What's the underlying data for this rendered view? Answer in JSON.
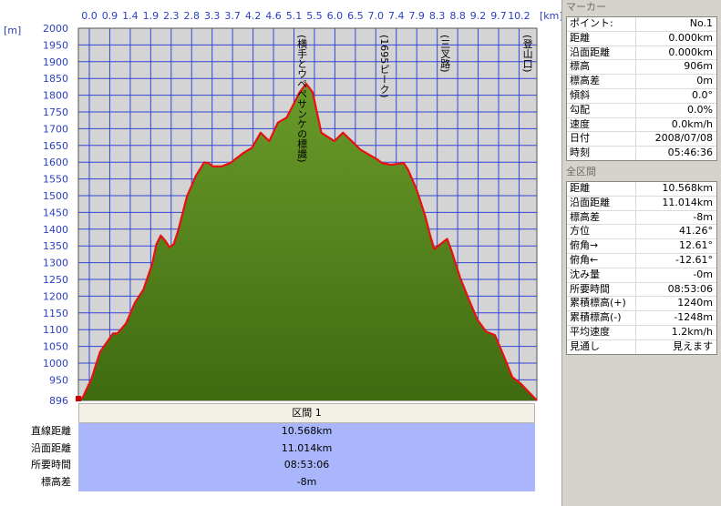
{
  "chart_data": {
    "type": "area",
    "x_unit_label": "[km]",
    "y_unit_label": "[m]",
    "x_ticks": [
      "0.0",
      "0.9",
      "1.4",
      "1.9",
      "2.3",
      "2.8",
      "3.3",
      "3.7",
      "4.2",
      "4.6",
      "5.1",
      "5.5",
      "6.0",
      "6.5",
      "7.0",
      "7.4",
      "7.9",
      "8.3",
      "8.8",
      "9.2",
      "9.7",
      "10.2"
    ],
    "y_ticks": [
      "2000",
      "1950",
      "1900",
      "1850",
      "1800",
      "1750",
      "1700",
      "1650",
      "1600",
      "1550",
      "1500",
      "1450",
      "1400",
      "1350",
      "1300",
      "1250",
      "1200",
      "1150",
      "1100",
      "1050",
      "1000",
      "950",
      "896"
    ],
    "xlim": [
      0,
      10.568
    ],
    "ylim": [
      896,
      2000
    ],
    "x": [
      0,
      0.1,
      0.3,
      0.5,
      0.8,
      0.9,
      1.1,
      1.3,
      1.5,
      1.7,
      1.8,
      1.9,
      2.0,
      2.1,
      2.2,
      2.3,
      2.5,
      2.7,
      2.9,
      3.0,
      3.1,
      3.3,
      3.5,
      3.8,
      4.0,
      4.2,
      4.4,
      4.6,
      4.8,
      5.0,
      5.1,
      5.25,
      5.4,
      5.6,
      5.9,
      6.1,
      6.3,
      6.5,
      6.7,
      6.9,
      7.0,
      7.2,
      7.5,
      7.6,
      7.8,
      8.0,
      8.1,
      8.2,
      8.35,
      8.5,
      8.6,
      8.8,
      9.0,
      9.2,
      9.4,
      9.6,
      9.8,
      10.0,
      10.2,
      10.568
    ],
    "y": [
      896,
      905,
      960,
      1040,
      1095,
      1095,
      1125,
      1185,
      1225,
      1300,
      1360,
      1385,
      1370,
      1350,
      1360,
      1400,
      1500,
      1560,
      1602,
      1600,
      1590,
      1590,
      1600,
      1630,
      1645,
      1690,
      1665,
      1720,
      1735,
      1785,
      1810,
      1835,
      1810,
      1690,
      1665,
      1690,
      1665,
      1640,
      1625,
      1610,
      1600,
      1595,
      1600,
      1580,
      1520,
      1440,
      1390,
      1345,
      1360,
      1375,
      1340,
      1260,
      1195,
      1135,
      1100,
      1090,
      1030,
      965,
      945,
      896
    ],
    "annotations": [
      {
        "text": "(横手とウペペサンケの標識)",
        "x": 5.15
      },
      {
        "text": "(1695ピーク)",
        "x": 7.05
      },
      {
        "text": "(三叉路)",
        "x": 8.45
      },
      {
        "text": "(登山口)",
        "x": 10.35
      }
    ]
  },
  "section": {
    "header": "区間 1",
    "rows": [
      {
        "label": "直線距離",
        "value": "10.568km"
      },
      {
        "label": "沿面距離",
        "value": "11.014km"
      },
      {
        "label": "所要時間",
        "value": "08:53:06"
      },
      {
        "label": "標高差",
        "value": "-8m"
      }
    ]
  },
  "panel": {
    "marker_title": "マーカー",
    "marker_rows": [
      {
        "k": "ポイント:",
        "v": "No.1"
      },
      {
        "k": "距離",
        "v": "0.000km"
      },
      {
        "k": "沿面距離",
        "v": "0.000km"
      },
      {
        "k": "標高",
        "v": "906m"
      },
      {
        "k": "標高差",
        "v": "0m"
      },
      {
        "k": "傾斜",
        "v": "0.0°"
      },
      {
        "k": "勾配",
        "v": "0.0%"
      },
      {
        "k": "速度",
        "v": "0.0km/h"
      },
      {
        "k": "日付",
        "v": "2008/07/08"
      },
      {
        "k": "時刻",
        "v": "05:46:36"
      }
    ],
    "total_title": "全区間",
    "total_rows": [
      {
        "k": "距離",
        "v": "10.568km"
      },
      {
        "k": "沿面距離",
        "v": "11.014km"
      },
      {
        "k": "標高差",
        "v": "-8m"
      },
      {
        "k": "方位",
        "v": "41.26°"
      },
      {
        "k": "俯角→",
        "v": "12.61°"
      },
      {
        "k": "俯角←",
        "v": "-12.61°"
      },
      {
        "k": "沈み量",
        "v": "-0m"
      },
      {
        "k": "所要時間",
        "v": "08:53:06"
      },
      {
        "k": "累積標高(+)",
        "v": "1240m"
      },
      {
        "k": "累積標高(-)",
        "v": "-1248m"
      },
      {
        "k": "平均速度",
        "v": "1.2km/h"
      },
      {
        "k": "見通し",
        "v": "見えます"
      }
    ]
  },
  "colors": {
    "fill_top": "#6a9a2a",
    "fill_bottom": "#3f6b10",
    "profile_line": "#e81010",
    "grid": "#3545d8",
    "plot_bg": "#d4d4d4",
    "tick_text": "#2a3fc0"
  }
}
